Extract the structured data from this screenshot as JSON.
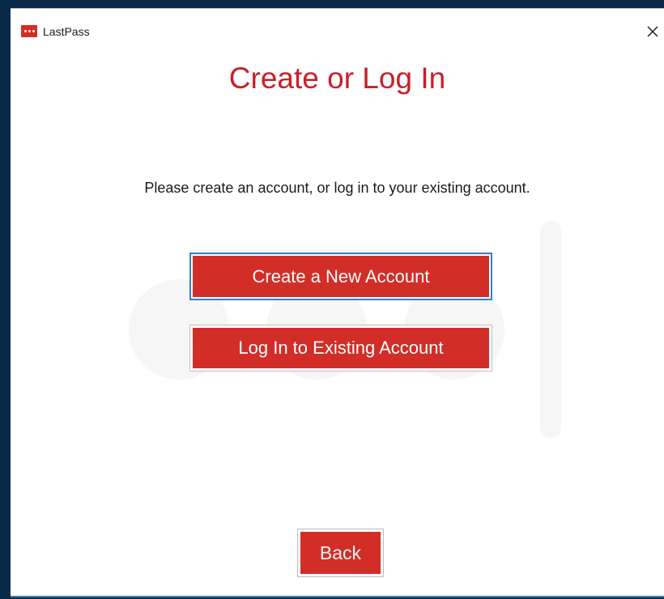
{
  "window": {
    "app_name": "LastPass",
    "app_icon": "lastpass-logo-icon",
    "close_icon": "close-icon"
  },
  "main": {
    "title": "Create or Log In",
    "subtitle": "Please create an account, or log in to your existing account.",
    "create_account_label": "Create a New Account",
    "login_label": "Log In to Existing Account",
    "back_label": "Back"
  },
  "colors": {
    "brand_red": "#d32d27",
    "title_red": "#c72029",
    "focus_blue": "#2f7fd1"
  }
}
